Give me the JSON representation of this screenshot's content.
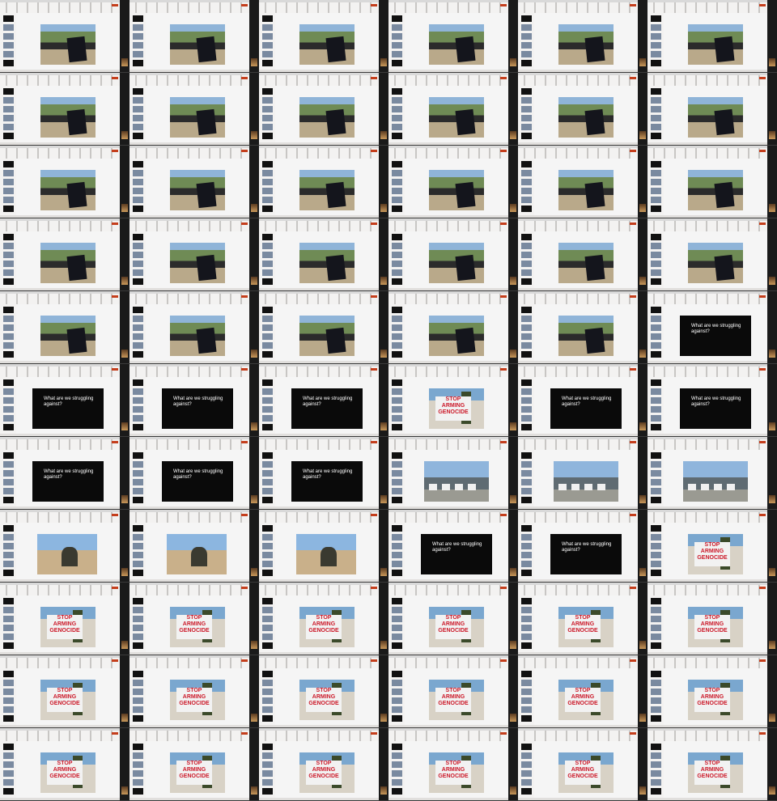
{
  "colors": {
    "black_slide": "#0a0a0a",
    "ribbon_accent": "#c43e1c",
    "sign_text": "#cc1a2a"
  },
  "rows": [
    [
      "crowd",
      "crowd",
      "crowd",
      "crowd",
      "crowd",
      "crowd"
    ],
    [
      "crowd",
      "crowd",
      "crowd",
      "crowd",
      "crowd",
      "crowd"
    ],
    [
      "crowd",
      "crowd",
      "crowd",
      "crowd",
      "crowd",
      "crowd"
    ],
    [
      "crowd",
      "crowd",
      "crowd",
      "crowd",
      "crowd",
      "crowd"
    ],
    [
      "crowd",
      "crowd",
      "crowd",
      "crowd",
      "crowd",
      "black"
    ],
    [
      "black",
      "black",
      "black",
      "banner",
      "black",
      "black"
    ],
    [
      "black",
      "black",
      "black",
      "street",
      "street",
      "street"
    ],
    [
      "field",
      "field",
      "field",
      "black",
      "black",
      "banner"
    ],
    [
      "banner",
      "banner",
      "banner",
      "banner",
      "banner",
      "banner"
    ],
    [
      "banner",
      "banner",
      "banner",
      "banner",
      "banner",
      "banner"
    ],
    [
      "banner",
      "banner",
      "banner",
      "banner",
      "banner",
      "banner"
    ]
  ],
  "slide_text": "What are we struggling against?",
  "banner_text": {
    "line1": "STOP",
    "line2": "ARMING",
    "line3": "GENOCIDE"
  },
  "icons": {
    "thumbnail": "slide-thumbnail-icon",
    "camera": "webcam-preview-icon"
  }
}
